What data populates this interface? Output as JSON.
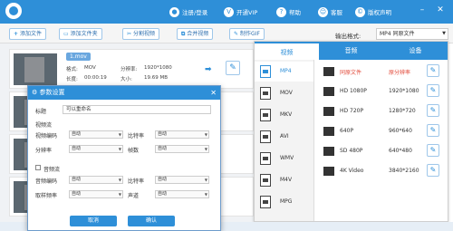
{
  "header": {
    "items": [
      {
        "icon": "user-icon",
        "label": "注册/登录"
      },
      {
        "icon": "vip-icon",
        "label": "开通VIP"
      },
      {
        "icon": "help-icon",
        "label": "帮助"
      },
      {
        "icon": "service-icon",
        "label": "客服"
      },
      {
        "icon": "copyright-icon",
        "label": "版权声明"
      }
    ]
  },
  "toolbar": {
    "add_file": "添加文件",
    "add_folder": "添加文件夹",
    "split_video": "分割视频",
    "merge_video": "合并视频",
    "make_gif": "制作GIF",
    "output_format_label": "输出格式:",
    "output_format_value": "MP4 同原文件"
  },
  "files": [
    {
      "name": "1.mov",
      "format_label": "格式:",
      "format": "MOV",
      "resolution_label": "分辨率:",
      "resolution": "1920*1080",
      "duration_label": "长度:",
      "duration": "00:00:19",
      "size_label": "大小:",
      "size": "19.69 MB"
    },
    {
      "name": "",
      "format_label": "",
      "format": "",
      "resolution_label": "",
      "resolution": "",
      "duration_label": "",
      "duration": "",
      "size_label": "",
      "size": ""
    },
    {
      "name": "",
      "format_label": "",
      "format": "",
      "resolution_label": "",
      "resolution": "",
      "duration_label": "",
      "duration": "",
      "size_label": "",
      "size": ""
    }
  ],
  "format_panel": {
    "tabs": [
      "视频",
      "音频",
      "设备"
    ],
    "formats": [
      "MP4",
      "MOV",
      "MKV",
      "AVI",
      "WMV",
      "M4V",
      "MPG"
    ],
    "presets": [
      {
        "name": "同原文件",
        "resolution": "原分辨率"
      },
      {
        "name": "HD 1080P",
        "resolution": "1920*1080"
      },
      {
        "name": "HD 720P",
        "resolution": "1280*720"
      },
      {
        "name": "640P",
        "resolution": "960*640"
      },
      {
        "name": "SD 480P",
        "resolution": "640*480"
      },
      {
        "name": "4K Video",
        "resolution": "3840*2160"
      }
    ]
  },
  "dialog": {
    "title": "参数设置",
    "title_label": "标题",
    "title_value": "可以重命名",
    "video_section": "视频流",
    "video_codec_label": "视频编码",
    "video_codec": "自动",
    "bitrate_label": "比特率",
    "bitrate": "自动",
    "resolution_label": "分辨率",
    "resolution": "自动",
    "framerate_label": "帧数",
    "framerate": "自动",
    "audio_section": "音频流",
    "audio_codec_label": "音频编码",
    "audio_codec": "自动",
    "audio_bitrate_label": "比特率",
    "audio_bitrate": "自动",
    "samplerate_label": "取样频率",
    "samplerate": "自动",
    "channel_label": "声道",
    "channel": "自动",
    "cancel": "取消",
    "confirm": "确认"
  }
}
